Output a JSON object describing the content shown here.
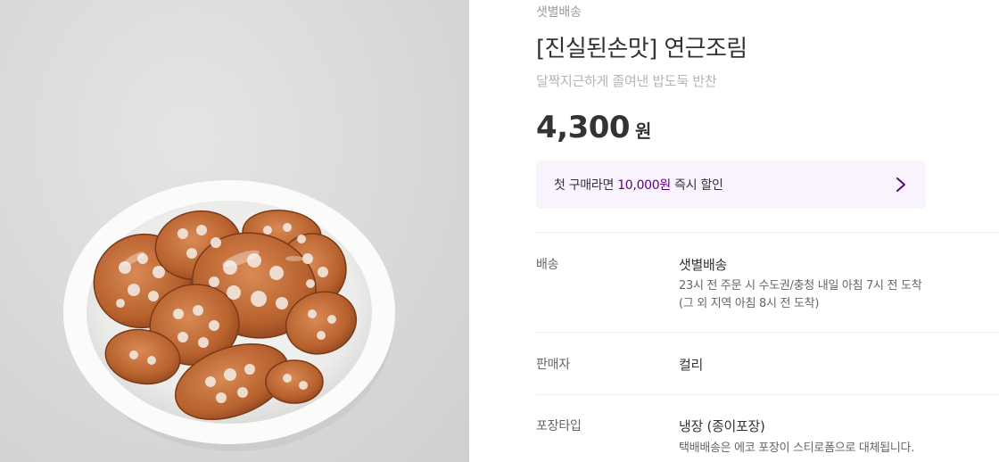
{
  "product": {
    "delivery_type": "샛별배송",
    "title": "[진실된손맛] 연근조림",
    "subtitle": "달짝지근하게 졸여낸 밥도둑 반찬",
    "price": "4,300",
    "price_unit": "원"
  },
  "coupon": {
    "text_before": "첫 구매라면 ",
    "highlight": "10,000원",
    "text_after": " 즉시 할인",
    "highlight_color": "#5f0080"
  },
  "info": [
    {
      "label": "배송",
      "value": "샛별배송",
      "desc1": "23시 전 주문 시 수도권/충청 내일 아침 7시 전 도착",
      "desc2": "(그 외 지역 아침 8시 전 도착)"
    },
    {
      "label": "판매자",
      "value": "컬리"
    },
    {
      "label": "포장타입",
      "value": "냉장 (종이포장)",
      "desc1": "택배배송은 에코 포장이 스티로폼으로 대체됩니다."
    }
  ],
  "icons": {
    "coupon_arrow": "chevron-right-icon"
  }
}
